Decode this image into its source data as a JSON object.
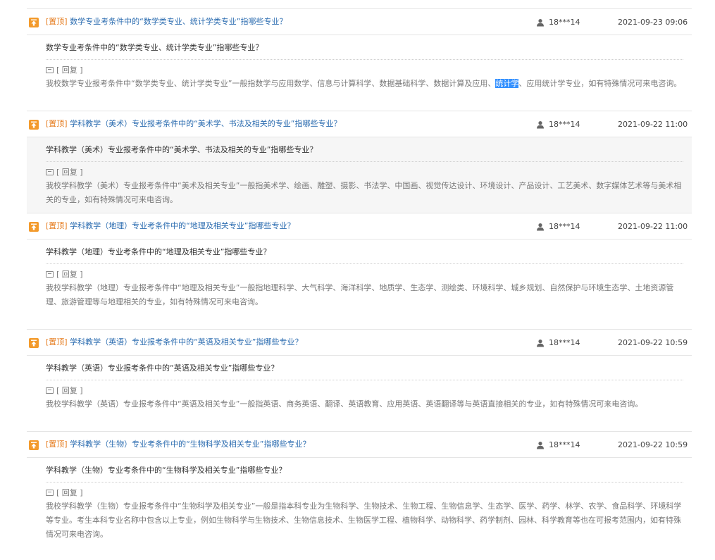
{
  "items": [
    {
      "pin_tag": "[置顶]",
      "title": "数学专业考条件中的“数学类专业、统计学类专业”指哪些专业？",
      "user": "18***14",
      "date": "2021-09-23 09:06",
      "question": "数学专业考条件中的“数学类专业、统计学类专业”指哪些专业？",
      "reply_label": "[ 回复 ]",
      "answer_before": "我校数学专业报考条件中“数学类专业、统计学类专业”一般指数学与应用数学、信息与计算科学、数据基础科学、数据计算及应用、",
      "answer_selected": "统计学",
      "answer_after": "、应用统计学专业，如有特殊情况可来电咨询。"
    },
    {
      "pin_tag": "[置顶]",
      "title": "学科教学（美术）专业报考条件中的“美术学、书法及相关的专业”指哪些专业？",
      "user": "18***14",
      "date": "2021-09-22 11:00",
      "question": "学科教学（美术）专业报考条件中的“美术学、书法及相关的专业”指哪些专业？",
      "reply_label": "[ 回复 ]",
      "answer": "我校学科教学（美术）专业报考条件中“美术及相关专业”一般指美术学、绘画、雕塑、摄影、书法学、中国画、视觉传达设计、环境设计、产品设计、工艺美术、数字媒体艺术等与美术相关的专业，如有特殊情况可来电咨询。"
    },
    {
      "pin_tag": "[置顶]",
      "title": "学科教学（地理）专业考条件中的“地理及相关专业”指哪些专业？",
      "user": "18***14",
      "date": "2021-09-22 11:00",
      "question": "学科教学（地理）专业考条件中的“地理及相关专业”指哪些专业？",
      "reply_label": "[ 回复 ]",
      "answer": "我校学科教学（地理）专业报考条件中“地理及相关专业”一般指地理科学、大气科学、海洋科学、地质学、生态学、测绘类、环境科学、城乡规划、自然保护与环境生态学、土地资源管理、旅游管理等与地理相关的专业，如有特殊情况可来电咨询。"
    },
    {
      "pin_tag": "[置顶]",
      "title": "学科教学（英语）专业报考条件中的“英语及相关专业”指哪些专业？",
      "user": "18***14",
      "date": "2021-09-22 10:59",
      "question": "学科教学（英语）专业报考条件中的“英语及相关专业”指哪些专业？",
      "reply_label": "[ 回复 ]",
      "answer": "我校学科教学（英语）专业报考条件中“英语及相关专业”一般指英语、商务英语、翻译、英语教育、应用英语、英语翻译等与英语直接相关的专业，如有特殊情况可来电咨询。"
    },
    {
      "pin_tag": "[置顶]",
      "title": "学科教学（生物）专业考条件中的“生物科学及相关专业”指哪些专业？",
      "user": "18***14",
      "date": "2021-09-22 10:59",
      "question": "学科教学（生物）专业考条件中的“生物科学及相关专业”指哪些专业？",
      "reply_label": "[ 回复 ]",
      "answer": "我校学科教学（生物）专业报考条件中“生物科学及相关专业”一般是指本科专业为生物科学、生物技术、生物工程、生物信息学、生态学、医学、药学、林学、农学、食品科学、环境科学等专业。考生本科专业名称中包含以上专业，例如生物科学与生物技术、生物信息技术、生物医学工程、植物科学、动物科学、药学制剂、园林、科学教育等也在可报考范围内，如有特殊情况可来电咨询。"
    }
  ]
}
